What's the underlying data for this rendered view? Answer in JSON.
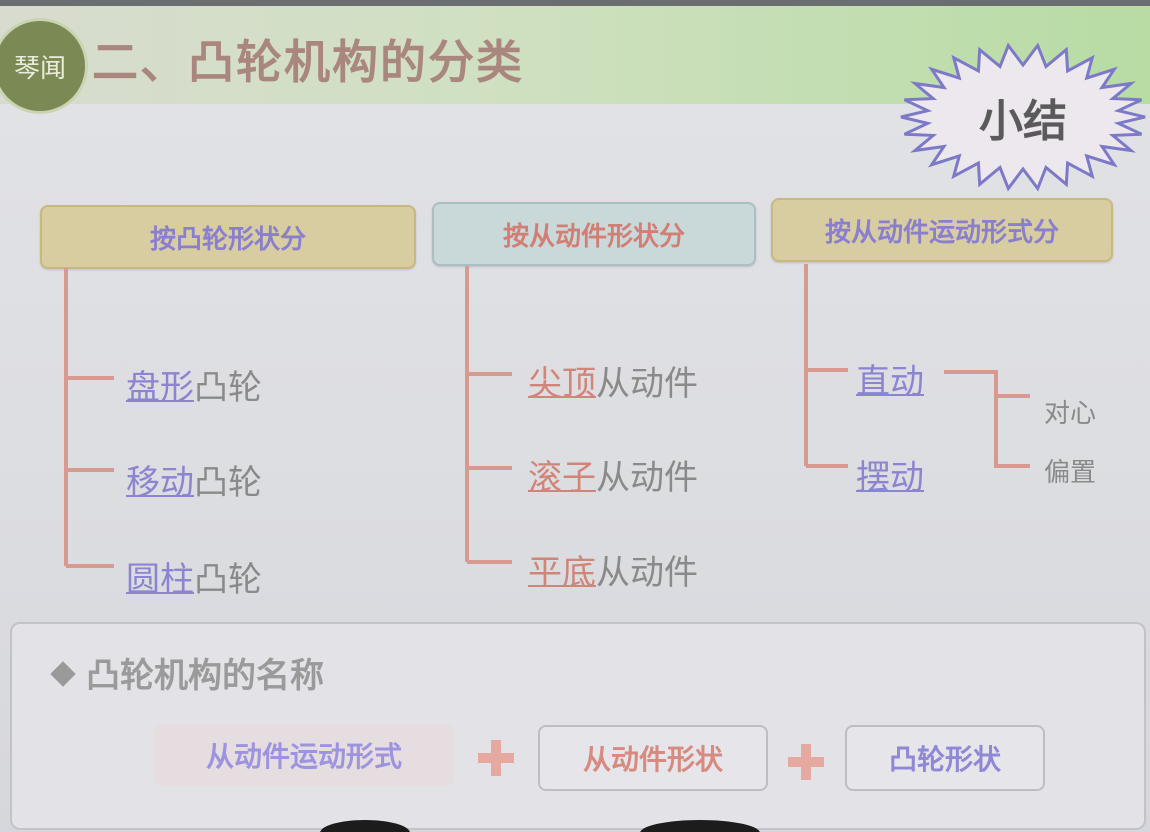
{
  "header": {
    "logo_text": "琴闻",
    "title": "二、凸轮机构的分类",
    "badge": "小结"
  },
  "categories": [
    {
      "label": "按凸轮形状分",
      "items": [
        {
          "highlight": "盘形",
          "rest": "凸轮"
        },
        {
          "highlight": "移动",
          "rest": "凸轮"
        },
        {
          "highlight": "圆柱",
          "rest": "凸轮"
        }
      ]
    },
    {
      "label": "按从动件形状分",
      "items": [
        {
          "highlight": "尖顶",
          "rest": "从动件"
        },
        {
          "highlight": "滚子",
          "rest": "从动件"
        },
        {
          "highlight": "平底",
          "rest": "从动件"
        }
      ]
    },
    {
      "label": "按从动件运动形式分",
      "items": [
        {
          "highlight": "直动",
          "rest": ""
        },
        {
          "highlight": "摆动",
          "rest": ""
        }
      ],
      "subitems": [
        "对心",
        "偏置"
      ]
    }
  ],
  "naming": {
    "title": "凸轮机构的名称",
    "parts": [
      "从动件运动形式",
      "从动件形状",
      "凸轮形状"
    ]
  },
  "colors": {
    "title": "#a9877e",
    "blue_text": "#8b84d0",
    "red_text": "#d18478",
    "tree_line": "#d89a90",
    "header_green": "#b7dca4"
  }
}
